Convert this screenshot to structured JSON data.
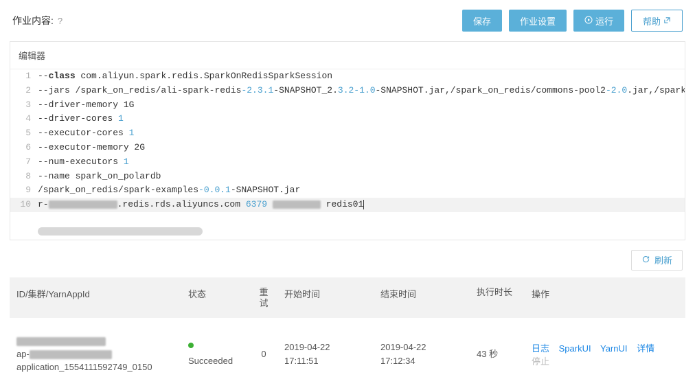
{
  "header": {
    "title": "作业内容:",
    "help_icon": "?",
    "save": "保存",
    "job_settings": "作业设置",
    "run": "运行",
    "help": "帮助"
  },
  "editor": {
    "title": "编辑器",
    "lines": {
      "l1_a": "--",
      "l1_kw": "class",
      "l1_b": " com.aliyun.spark.redis.SparkOnRedisSparkSession",
      "l2_a": "--jars /spark_on_redis/ali-spark-redis",
      "l2_n1": "-2.3.1",
      "l2_b": "-SNAPSHOT_2.",
      "l2_n2": "3.2-1.0",
      "l2_c": "-SNAPSHOT.jar,/spark_on_redis/commons-pool2",
      "l2_n3": "-2.0",
      "l2_d": ".jar,/spark_on_redis/j",
      "l3_a": "--driver-memory 1G",
      "l4_a": "--driver-cores ",
      "l4_n1": "1",
      "l5_a": "--executor-cores ",
      "l5_n1": "1",
      "l6_a": "--executor-memory 2G",
      "l7_a": "--num-executors ",
      "l7_n1": "1",
      "l8_a": "--name spark_on_polardb",
      "l9_a": "/spark_on_redis/spark-examples",
      "l9_n1": "-0.0.1",
      "l9_b": "-SNAPSHOT.jar",
      "l10_a": "r-",
      "l10_b": ".redis.rds.aliyuncs.com ",
      "l10_n1": "6379",
      "l10_c": " ",
      "l10_d": " redis01"
    }
  },
  "refresh": "刷新",
  "table": {
    "head": {
      "id": "ID/集群/YarnAppId",
      "status": "状态",
      "retry": "重试",
      "start": "开始时间",
      "end": "结束时间",
      "duration": "执行时长",
      "ops": "操作"
    },
    "row": {
      "cluster_prefix": "ap-",
      "app_id": "application_1554111592749_0150",
      "status": "Succeeded",
      "retry": "0",
      "start_date": "2019-04-22",
      "start_time": "17:11:51",
      "end_date": "2019-04-22",
      "end_time": "17:12:34",
      "duration": "43 秒",
      "op_log": "日志",
      "op_spark": "SparkUI",
      "op_yarn": "YarnUI",
      "op_detail": "详情",
      "op_stop": "停止"
    }
  }
}
